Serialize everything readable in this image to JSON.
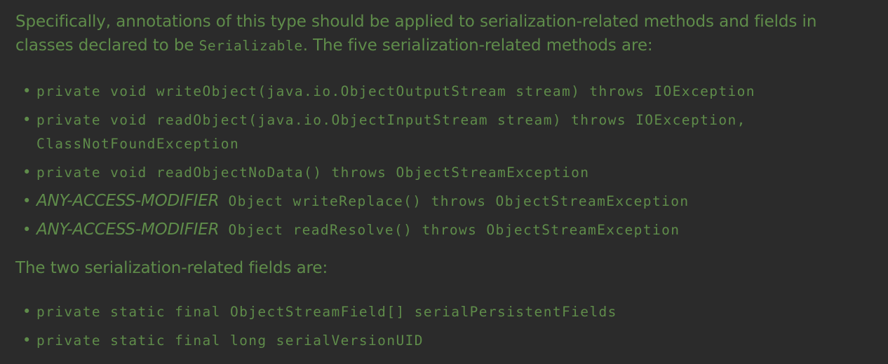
{
  "intro": {
    "line1": "Specifically, annotations of this type should be applied to serialization-related methods and fields in",
    "line2_before": "classes declared to be ",
    "line2_code": "Serializable",
    "line2_after": ". The five serialization-related methods are:"
  },
  "methods": [
    {
      "sig": "private void writeObject(java.io.ObjectOutputStream stream) throws IOException"
    },
    {
      "sig": "private void readObject(java.io.ObjectInputStream stream) throws IOException,",
      "sig_cont": "ClassNotFoundException"
    },
    {
      "sig": "private void readObjectNoData() throws ObjectStreamException"
    },
    {
      "modifier": "ANY-ACCESS-MODIFIER",
      "sig": " Object writeReplace() throws ObjectStreamException"
    },
    {
      "modifier": "ANY-ACCESS-MODIFIER",
      "sig": " Object readResolve() throws ObjectStreamException"
    }
  ],
  "fields_intro": "The two serialization-related fields are:",
  "fields": [
    {
      "sig": "private static final ObjectStreamField[] serialPersistentFields"
    },
    {
      "sig": "private static final long serialVersionUID"
    }
  ],
  "bullet": "•"
}
